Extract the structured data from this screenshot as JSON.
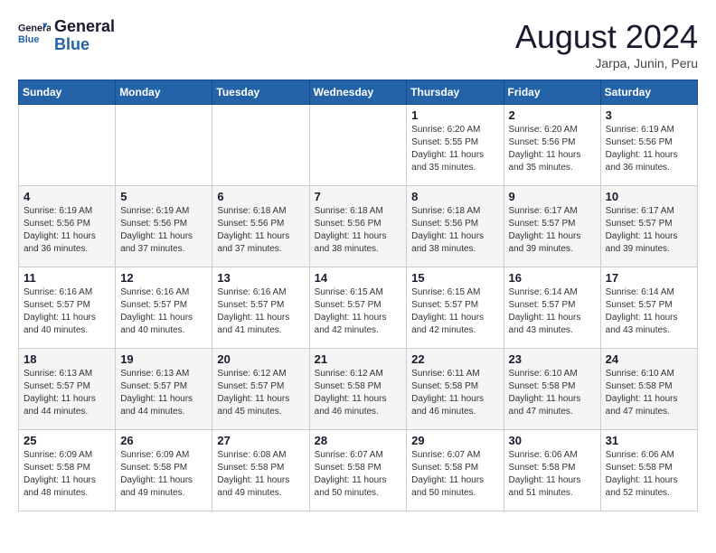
{
  "header": {
    "logo_line1": "General",
    "logo_line2": "Blue",
    "month_year": "August 2024",
    "location": "Jarpa, Junin, Peru"
  },
  "weekdays": [
    "Sunday",
    "Monday",
    "Tuesday",
    "Wednesday",
    "Thursday",
    "Friday",
    "Saturday"
  ],
  "weeks": [
    [
      {
        "day": "",
        "info": ""
      },
      {
        "day": "",
        "info": ""
      },
      {
        "day": "",
        "info": ""
      },
      {
        "day": "",
        "info": ""
      },
      {
        "day": "1",
        "info": "Sunrise: 6:20 AM\nSunset: 5:55 PM\nDaylight: 11 hours\nand 35 minutes."
      },
      {
        "day": "2",
        "info": "Sunrise: 6:20 AM\nSunset: 5:56 PM\nDaylight: 11 hours\nand 35 minutes."
      },
      {
        "day": "3",
        "info": "Sunrise: 6:19 AM\nSunset: 5:56 PM\nDaylight: 11 hours\nand 36 minutes."
      }
    ],
    [
      {
        "day": "4",
        "info": "Sunrise: 6:19 AM\nSunset: 5:56 PM\nDaylight: 11 hours\nand 36 minutes."
      },
      {
        "day": "5",
        "info": "Sunrise: 6:19 AM\nSunset: 5:56 PM\nDaylight: 11 hours\nand 37 minutes."
      },
      {
        "day": "6",
        "info": "Sunrise: 6:18 AM\nSunset: 5:56 PM\nDaylight: 11 hours\nand 37 minutes."
      },
      {
        "day": "7",
        "info": "Sunrise: 6:18 AM\nSunset: 5:56 PM\nDaylight: 11 hours\nand 38 minutes."
      },
      {
        "day": "8",
        "info": "Sunrise: 6:18 AM\nSunset: 5:56 PM\nDaylight: 11 hours\nand 38 minutes."
      },
      {
        "day": "9",
        "info": "Sunrise: 6:17 AM\nSunset: 5:57 PM\nDaylight: 11 hours\nand 39 minutes."
      },
      {
        "day": "10",
        "info": "Sunrise: 6:17 AM\nSunset: 5:57 PM\nDaylight: 11 hours\nand 39 minutes."
      }
    ],
    [
      {
        "day": "11",
        "info": "Sunrise: 6:16 AM\nSunset: 5:57 PM\nDaylight: 11 hours\nand 40 minutes."
      },
      {
        "day": "12",
        "info": "Sunrise: 6:16 AM\nSunset: 5:57 PM\nDaylight: 11 hours\nand 40 minutes."
      },
      {
        "day": "13",
        "info": "Sunrise: 6:16 AM\nSunset: 5:57 PM\nDaylight: 11 hours\nand 41 minutes."
      },
      {
        "day": "14",
        "info": "Sunrise: 6:15 AM\nSunset: 5:57 PM\nDaylight: 11 hours\nand 42 minutes."
      },
      {
        "day": "15",
        "info": "Sunrise: 6:15 AM\nSunset: 5:57 PM\nDaylight: 11 hours\nand 42 minutes."
      },
      {
        "day": "16",
        "info": "Sunrise: 6:14 AM\nSunset: 5:57 PM\nDaylight: 11 hours\nand 43 minutes."
      },
      {
        "day": "17",
        "info": "Sunrise: 6:14 AM\nSunset: 5:57 PM\nDaylight: 11 hours\nand 43 minutes."
      }
    ],
    [
      {
        "day": "18",
        "info": "Sunrise: 6:13 AM\nSunset: 5:57 PM\nDaylight: 11 hours\nand 44 minutes."
      },
      {
        "day": "19",
        "info": "Sunrise: 6:13 AM\nSunset: 5:57 PM\nDaylight: 11 hours\nand 44 minutes."
      },
      {
        "day": "20",
        "info": "Sunrise: 6:12 AM\nSunset: 5:57 PM\nDaylight: 11 hours\nand 45 minutes."
      },
      {
        "day": "21",
        "info": "Sunrise: 6:12 AM\nSunset: 5:58 PM\nDaylight: 11 hours\nand 46 minutes."
      },
      {
        "day": "22",
        "info": "Sunrise: 6:11 AM\nSunset: 5:58 PM\nDaylight: 11 hours\nand 46 minutes."
      },
      {
        "day": "23",
        "info": "Sunrise: 6:10 AM\nSunset: 5:58 PM\nDaylight: 11 hours\nand 47 minutes."
      },
      {
        "day": "24",
        "info": "Sunrise: 6:10 AM\nSunset: 5:58 PM\nDaylight: 11 hours\nand 47 minutes."
      }
    ],
    [
      {
        "day": "25",
        "info": "Sunrise: 6:09 AM\nSunset: 5:58 PM\nDaylight: 11 hours\nand 48 minutes."
      },
      {
        "day": "26",
        "info": "Sunrise: 6:09 AM\nSunset: 5:58 PM\nDaylight: 11 hours\nand 49 minutes."
      },
      {
        "day": "27",
        "info": "Sunrise: 6:08 AM\nSunset: 5:58 PM\nDaylight: 11 hours\nand 49 minutes."
      },
      {
        "day": "28",
        "info": "Sunrise: 6:07 AM\nSunset: 5:58 PM\nDaylight: 11 hours\nand 50 minutes."
      },
      {
        "day": "29",
        "info": "Sunrise: 6:07 AM\nSunset: 5:58 PM\nDaylight: 11 hours\nand 50 minutes."
      },
      {
        "day": "30",
        "info": "Sunrise: 6:06 AM\nSunset: 5:58 PM\nDaylight: 11 hours\nand 51 minutes."
      },
      {
        "day": "31",
        "info": "Sunrise: 6:06 AM\nSunset: 5:58 PM\nDaylight: 11 hours\nand 52 minutes."
      }
    ]
  ]
}
